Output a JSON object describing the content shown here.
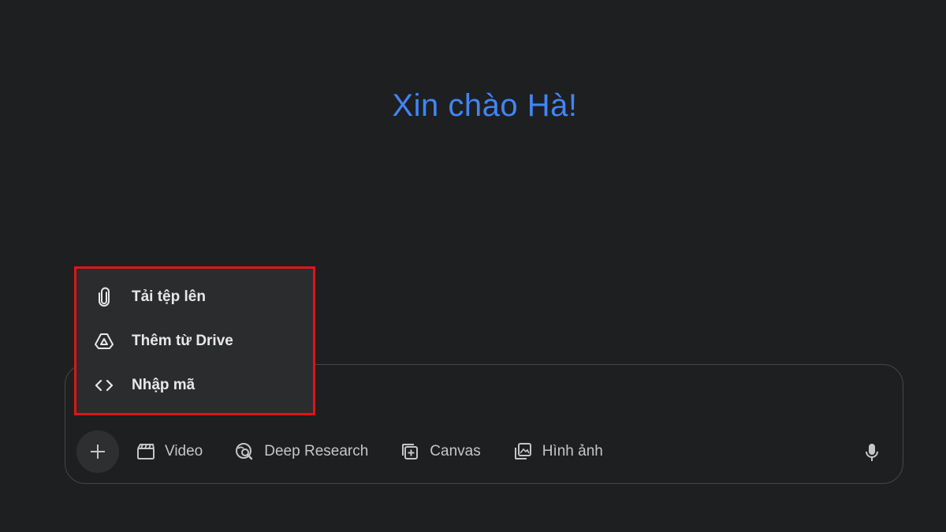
{
  "greeting": "Xin chào Hà!",
  "menu": {
    "items": [
      {
        "label": "Tải tệp lên",
        "icon": "paperclip-icon"
      },
      {
        "label": "Thêm từ Drive",
        "icon": "drive-icon"
      },
      {
        "label": "Nhập mã",
        "icon": "code-icon"
      }
    ]
  },
  "toolbar": {
    "plus_icon": "plus-icon",
    "tools": [
      {
        "label": "Video",
        "icon": "clapperboard-icon"
      },
      {
        "label": "Deep Research",
        "icon": "deep-research-icon"
      },
      {
        "label": "Canvas",
        "icon": "canvas-icon"
      },
      {
        "label": "Hình ảnh",
        "icon": "image-gallery-icon"
      }
    ],
    "mic_icon": "microphone-icon"
  },
  "colors": {
    "background": "#1e1f21",
    "greeting": "#4285f4",
    "highlight_border": "#e01515",
    "menu_background": "#2b2c2e",
    "text": "#c4c7c5"
  }
}
